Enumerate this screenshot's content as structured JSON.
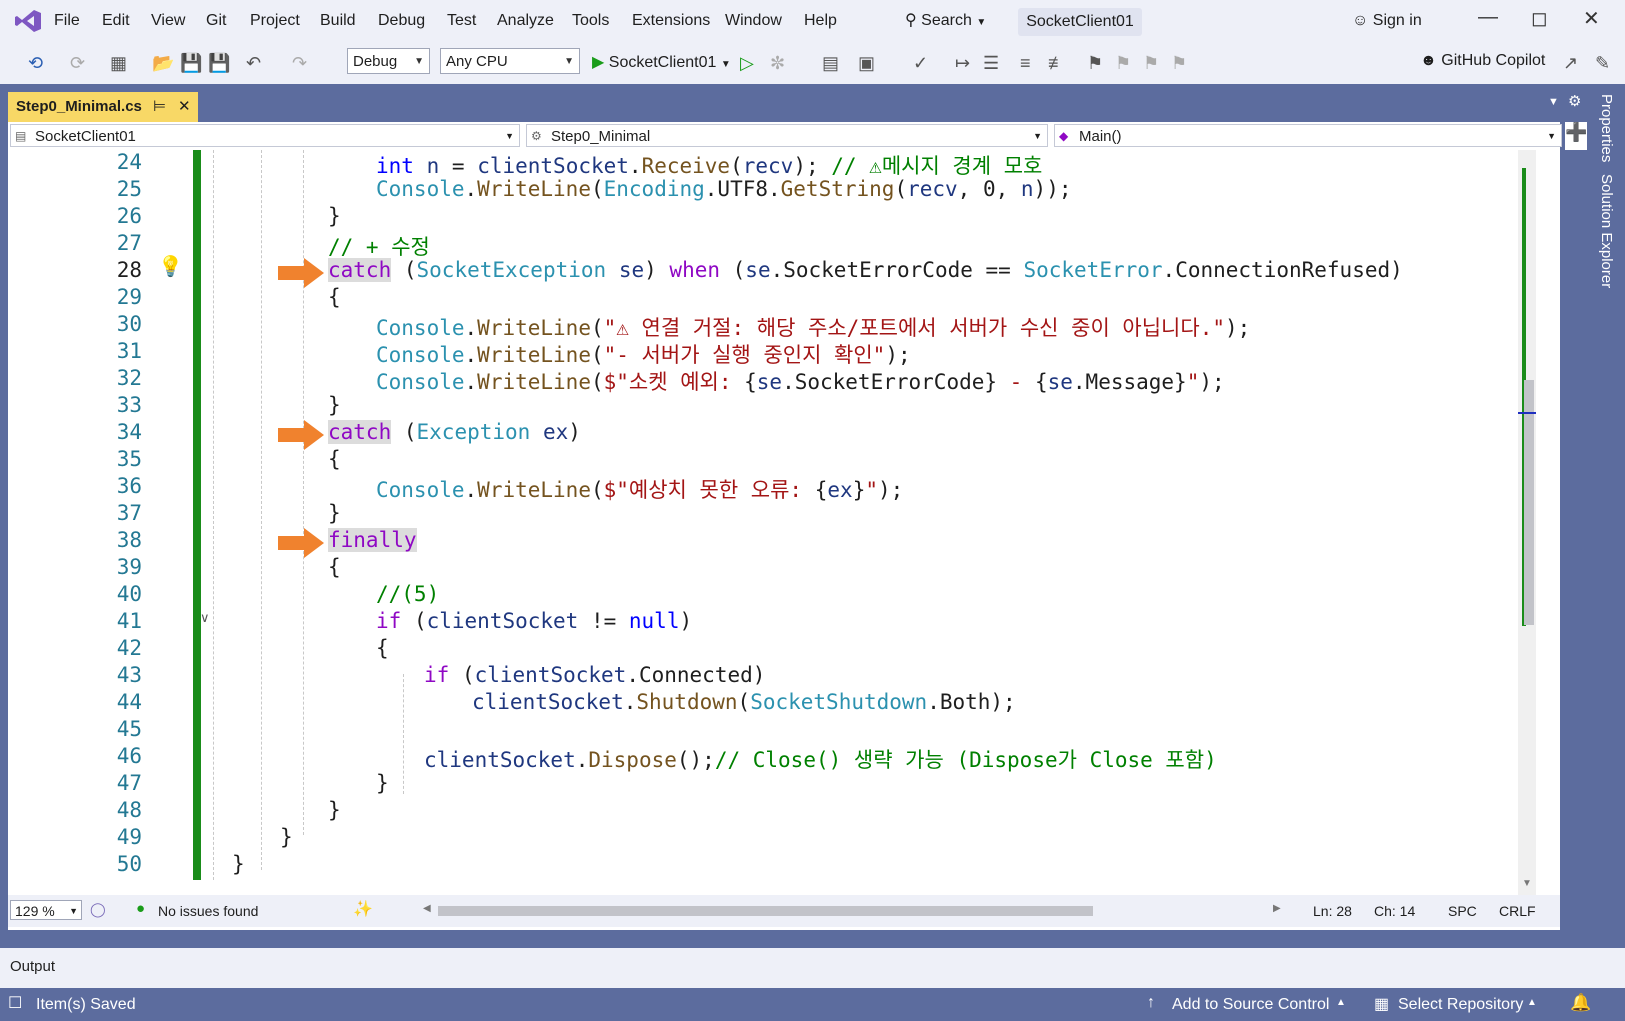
{
  "menu": [
    "File",
    "Edit",
    "View",
    "Git",
    "Project",
    "Build",
    "Debug",
    "Test",
    "Analyze",
    "Tools",
    "Extensions",
    "Window",
    "Help"
  ],
  "search_label": "Search",
  "solution_name": "SocketClient01",
  "sign_in": "Sign in",
  "toolbar": {
    "config": "Debug",
    "platform": "Any CPU",
    "run_target": "SocketClient01",
    "copilot": "GitHub Copilot"
  },
  "editor": {
    "tab_title": "Step0_Minimal.cs",
    "nav_project": "SocketClient01",
    "nav_class": "Step0_Minimal",
    "nav_member": "Main()",
    "line_numbers": [
      "24",
      "25",
      "26",
      "27",
      "28",
      "29",
      "30",
      "31",
      "32",
      "33",
      "34",
      "35",
      "36",
      "37",
      "38",
      "39",
      "40",
      "41",
      "42",
      "43",
      "44",
      "45",
      "46",
      "47",
      "48",
      "49",
      "50"
    ],
    "zoom": "129 %",
    "issues": "No issues found",
    "ln": "Ln: 28",
    "ch": "Ch: 14",
    "spc": "SPC",
    "crlf": "CRLF"
  },
  "side_panels": [
    "Properties",
    "Solution Explorer"
  ],
  "output_label": "Output",
  "status": {
    "message": "Item(s) Saved",
    "source_control": "Add to Source Control",
    "repository": "Select Repository"
  }
}
